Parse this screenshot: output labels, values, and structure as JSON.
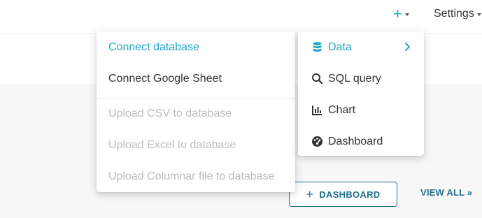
{
  "navbar": {
    "new_menu_icon": "plus-icon",
    "settings_label": "Settings"
  },
  "main_menu": {
    "items": [
      {
        "label": "Data",
        "icon": "database-icon",
        "has_submenu": true,
        "active": true
      },
      {
        "label": "SQL query",
        "icon": "search-icon"
      },
      {
        "label": "Chart",
        "icon": "bar-chart-icon"
      },
      {
        "label": "Dashboard",
        "icon": "dashboard-gauge-icon"
      }
    ]
  },
  "data_submenu": {
    "items": [
      {
        "label": "Connect database",
        "state": "active"
      },
      {
        "label": "Connect Google Sheet",
        "state": "enabled"
      },
      {
        "label": "Upload CSV to database",
        "state": "disabled"
      },
      {
        "label": "Upload Excel to database",
        "state": "disabled"
      },
      {
        "label": "Upload Columnar file to database",
        "state": "disabled"
      }
    ]
  },
  "content": {
    "dashboard_button_label": "DASHBOARD",
    "view_all_label": "VIEW ALL »"
  },
  "colors": {
    "accent": "#20a7c9",
    "primary_dark": "#1f6f89",
    "disabled_text": "#bdbdbd",
    "background": "#f7f7f7"
  }
}
